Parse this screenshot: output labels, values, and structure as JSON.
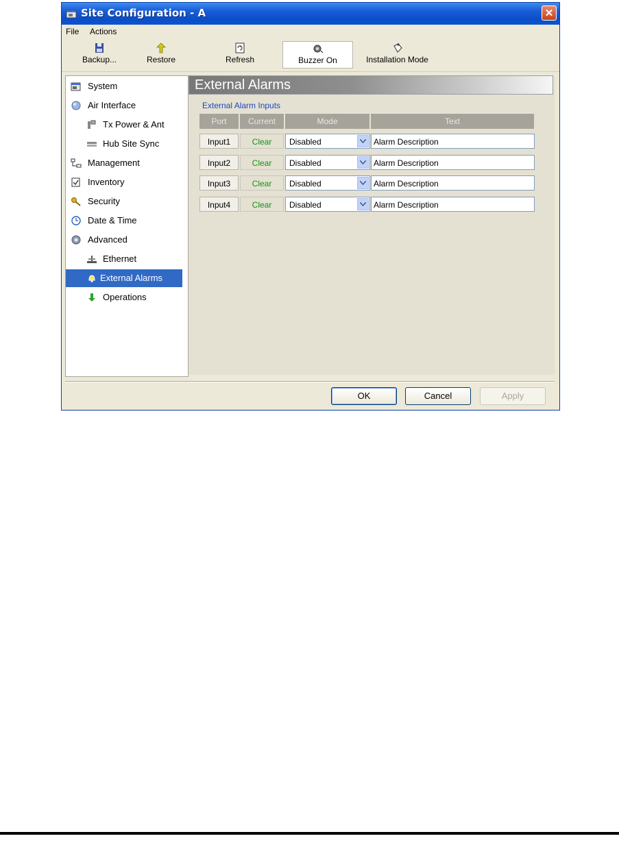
{
  "window": {
    "title": "Site Configuration - A",
    "close_label": "✕"
  },
  "menu": {
    "items": [
      "File",
      "Actions"
    ]
  },
  "toolbar": {
    "backup": "Backup...",
    "restore": "Restore",
    "refresh": "Refresh",
    "buzzer": "Buzzer On",
    "installation": "Installation Mode"
  },
  "nav": {
    "items": [
      {
        "label": "System",
        "icon": "system-icon"
      },
      {
        "label": "Air Interface",
        "icon": "air-interface-icon"
      },
      {
        "label": "Tx Power & Ant",
        "icon": "tx-power-icon"
      },
      {
        "label": "Hub Site Sync",
        "icon": "hub-sync-icon"
      },
      {
        "label": "Management",
        "icon": "management-icon"
      },
      {
        "label": "Inventory",
        "icon": "inventory-icon"
      },
      {
        "label": "Security",
        "icon": "security-icon"
      },
      {
        "label": "Date & Time",
        "icon": "clock-icon"
      },
      {
        "label": "Advanced",
        "icon": "advanced-icon"
      },
      {
        "label": "Ethernet",
        "icon": "ethernet-icon"
      },
      {
        "label": "External Alarms",
        "icon": "alarm-bell-icon"
      },
      {
        "label": "Operations",
        "icon": "operations-arrow-icon"
      }
    ],
    "selected": "External Alarms"
  },
  "content": {
    "title": "External Alarms",
    "section_label": "External Alarm Inputs",
    "columns": [
      "Port",
      "Current",
      "Mode",
      "Text"
    ],
    "rows": [
      {
        "port": "Input1",
        "current": "Clear",
        "mode": "Disabled",
        "text": "Alarm Description"
      },
      {
        "port": "Input2",
        "current": "Clear",
        "mode": "Disabled",
        "text": "Alarm Description"
      },
      {
        "port": "Input3",
        "current": "Clear",
        "mode": "Disabled",
        "text": "Alarm Description"
      },
      {
        "port": "Input4",
        "current": "Clear",
        "mode": "Disabled",
        "text": "Alarm Description"
      }
    ]
  },
  "buttons": {
    "ok": "OK",
    "cancel": "Cancel",
    "apply": "Apply"
  },
  "colors": {
    "titlebar": "#0a4ec8",
    "selection": "#316ac5",
    "status_clear": "#159015"
  }
}
